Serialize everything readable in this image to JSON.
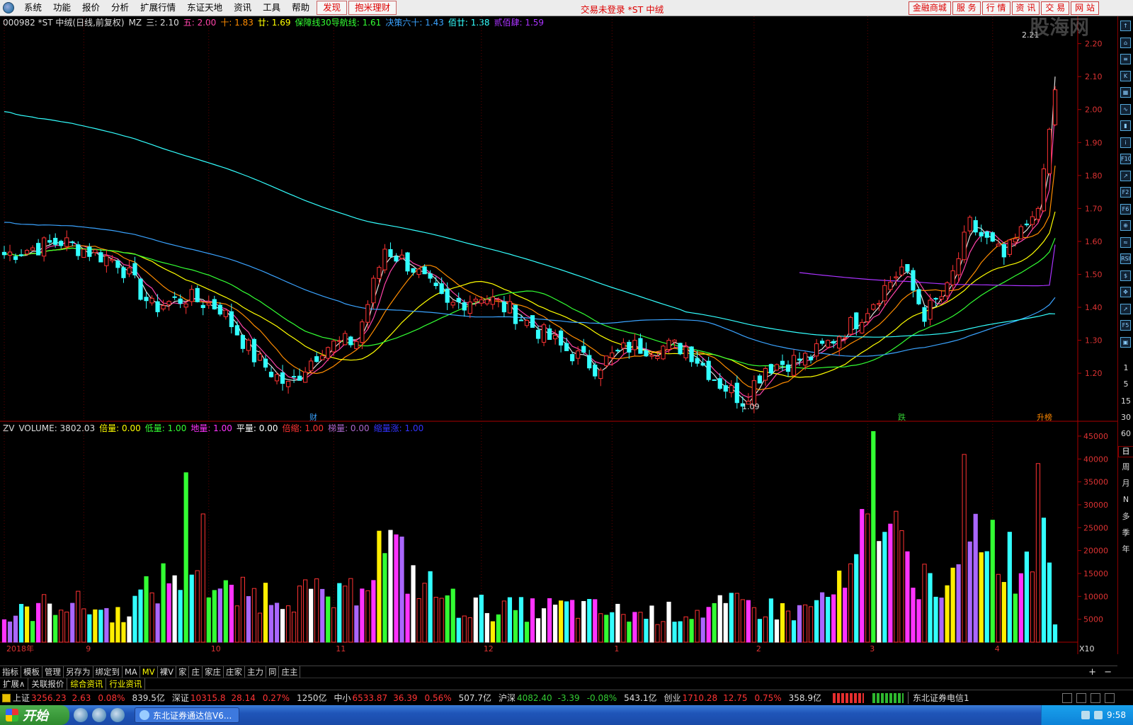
{
  "menu": {
    "items": [
      "系统",
      "功能",
      "报价",
      "分析",
      "扩展行情",
      "东证天地",
      "资讯",
      "工具",
      "帮助"
    ],
    "highlight_items": [
      "发现",
      "抱米理财"
    ],
    "status": "交易未登录 *ST 中绒",
    "right_buttons": [
      "金融商城",
      "服 务",
      "行 情",
      "资 讯",
      "交 易",
      "网 站"
    ]
  },
  "main": {
    "header_parts": [
      {
        "text": "000982 *ST 中绒(日线,前复权)",
        "color": "#dddddd"
      },
      {
        "text": "MZ",
        "color": "#dddddd"
      },
      {
        "text": "三: 2.10",
        "color": "#dddddd"
      },
      {
        "text": "五: 2.00",
        "color": "#ff44aa"
      },
      {
        "text": "十: 1.83",
        "color": "#ff8c00"
      },
      {
        "text": "廿: 1.69",
        "color": "#ffff00"
      },
      {
        "text": "保障线30导航线: 1.61",
        "color": "#33ff33"
      },
      {
        "text": "决策六十: 1.43",
        "color": "#3aa3ff"
      },
      {
        "text": "佰廿: 1.38",
        "color": "#33ffff"
      },
      {
        "text": "贰佰肆: 1.59",
        "color": "#aa33ff"
      }
    ],
    "last_price_label": "2.21",
    "low_label": "1.09",
    "event_labels": [
      {
        "text": "财",
        "color": "#3aa3ff"
      },
      {
        "text": "跌",
        "color": "#33cc33"
      },
      {
        "text": "升榜",
        "color": "#ff8800"
      }
    ]
  },
  "volume": {
    "header_parts": [
      {
        "text": "ZV",
        "color": "#dddddd"
      },
      {
        "text": "VOLUME: 3802.03",
        "color": "#dddddd"
      },
      {
        "text": "倍量: 0.00",
        "color": "#ffff00"
      },
      {
        "text": "低量: 1.00",
        "color": "#33ff33"
      },
      {
        "text": "地量: 1.00",
        "color": "#ff33ff"
      },
      {
        "text": "平量: 0.00",
        "color": "#ffffff"
      },
      {
        "text": "倍缩: 1.00",
        "color": "#ff3333"
      },
      {
        "text": "梯量: 0.00",
        "color": "#aa66cc"
      },
      {
        "text": "缩量涨: 1.00",
        "color": "#3333ff"
      }
    ],
    "x10": "X10"
  },
  "chart_data": [
    {
      "type": "candlestick",
      "title": "000982 *ST 中绒(日线,前复权)",
      "price_ticks": [
        "2.20",
        "2.10",
        "2.00",
        "1.90",
        "1.80",
        "1.70",
        "1.60",
        "1.50",
        "1.40",
        "1.30",
        "1.20"
      ],
      "price_tick_values": [
        2.2,
        2.1,
        2.0,
        1.9,
        1.8,
        1.7,
        1.6,
        1.5,
        1.4,
        1.3,
        1.2
      ],
      "ylim": [
        1.08,
        2.24
      ],
      "x_axis_labels": [
        "2018年",
        "9",
        "10",
        "11",
        "12",
        "1",
        "2",
        "3",
        "4"
      ],
      "x_axis_label_index": [
        0,
        14,
        36,
        58,
        84,
        107,
        132,
        152,
        174
      ],
      "n_bars": 186,
      "anchors": [
        [
          0,
          1.56
        ],
        [
          10,
          1.6
        ],
        [
          20,
          1.54
        ],
        [
          26,
          1.4
        ],
        [
          32,
          1.43
        ],
        [
          38,
          1.4
        ],
        [
          44,
          1.25
        ],
        [
          50,
          1.16
        ],
        [
          56,
          1.28
        ],
        [
          62,
          1.3
        ],
        [
          67,
          1.58
        ],
        [
          72,
          1.52
        ],
        [
          78,
          1.4
        ],
        [
          84,
          1.44
        ],
        [
          90,
          1.38
        ],
        [
          98,
          1.28
        ],
        [
          104,
          1.22
        ],
        [
          110,
          1.28
        ],
        [
          120,
          1.28
        ],
        [
          126,
          1.17
        ],
        [
          130,
          1.12
        ],
        [
          134,
          1.22
        ],
        [
          142,
          1.25
        ],
        [
          150,
          1.36
        ],
        [
          158,
          1.52
        ],
        [
          162,
          1.38
        ],
        [
          166,
          1.45
        ],
        [
          170,
          1.65
        ],
        [
          176,
          1.55
        ],
        [
          182,
          1.7
        ],
        [
          185,
          2.06
        ]
      ],
      "ma_series": [
        {
          "name": "三",
          "window": 3,
          "value": 2.1,
          "color": "#dddddd"
        },
        {
          "name": "五",
          "window": 5,
          "value": 2.0,
          "color": "#ff44aa"
        },
        {
          "name": "十",
          "window": 10,
          "value": 1.83,
          "color": "#ff8c00"
        },
        {
          "name": "廿",
          "window": 20,
          "value": 1.69,
          "color": "#ffff00"
        },
        {
          "name": "保障线30导航线",
          "window": 30,
          "value": 1.61,
          "color": "#33ff33"
        },
        {
          "name": "决策六十",
          "window": 60,
          "value": 1.43,
          "color": "#3aa3ff"
        },
        {
          "name": "佰廿",
          "window": 120,
          "value": 1.38,
          "color": "#33ffff"
        },
        {
          "name": "贰佰肆",
          "window": 240,
          "value": 1.59,
          "color": "#aa33ff"
        }
      ],
      "annotations": [
        "2.21",
        "1.09"
      ]
    },
    {
      "type": "bar",
      "title": "ZV VOLUME: 3802.03",
      "vol_ticks": [
        "45000",
        "40000",
        "35000",
        "30000",
        "25000",
        "20000",
        "15000",
        "10000",
        "5000"
      ],
      "vol_tick_values": [
        45000,
        40000,
        35000,
        30000,
        25000,
        20000,
        15000,
        10000,
        5000
      ],
      "ylim": [
        0,
        47000
      ],
      "volume_anchors": [
        [
          0,
          5000
        ],
        [
          10,
          9000
        ],
        [
          20,
          6000
        ],
        [
          30,
          15000
        ],
        [
          40,
          10000
        ],
        [
          50,
          11000
        ],
        [
          60,
          9000
        ],
        [
          67,
          22000
        ],
        [
          72,
          14000
        ],
        [
          80,
          8000
        ],
        [
          90,
          7000
        ],
        [
          100,
          7500
        ],
        [
          110,
          6000
        ],
        [
          120,
          6500
        ],
        [
          130,
          8000
        ],
        [
          140,
          6500
        ],
        [
          148,
          12000
        ],
        [
          155,
          25000
        ],
        [
          160,
          16000
        ],
        [
          166,
          11000
        ],
        [
          172,
          26000
        ],
        [
          178,
          17000
        ],
        [
          184,
          21000
        ],
        [
          185,
          3800
        ]
      ],
      "spikes": [
        [
          32,
          37000
        ],
        [
          35,
          28000
        ],
        [
          153,
          46000
        ],
        [
          169,
          41000
        ],
        [
          182,
          39000
        ],
        [
          151,
          29000
        ],
        [
          152,
          28000
        ],
        [
          154,
          22000
        ],
        [
          155,
          24000
        ]
      ]
    }
  ],
  "sidebar": {
    "icons": [
      "up-arrow-icon",
      "home-icon",
      "list-icon",
      "k-icon",
      "grid-icon",
      "line-icon",
      "bar-icon",
      "info-icon",
      "f10-icon",
      "rise-icon",
      "f2-icon",
      "f6-icon",
      "zoom-icon",
      "wave-icon",
      "rsi-icon",
      "dollar-icon",
      "move-icon",
      "arrow-icon",
      "f5-icon",
      "chart-icon"
    ],
    "icon_texts": [
      "↑",
      "⌂",
      "≡",
      "K",
      "▦",
      "∿",
      "▮",
      "i",
      "F10",
      "↗",
      "F2",
      "F6",
      "⊕",
      "≈",
      "RSI",
      "$",
      "✥",
      "➚",
      "F5",
      "▣"
    ],
    "periods": [
      "1",
      "5",
      "15",
      "30",
      "60",
      "日",
      "周",
      "月",
      "N",
      "多",
      "季",
      "年"
    ],
    "selected_period": "日"
  },
  "x_axis": {
    "period_label": "日线"
  },
  "tabs1": {
    "items": [
      "指标",
      "模板",
      "管理",
      "另存为",
      "绑定到",
      "MA",
      "MV",
      "裸V",
      "家",
      "庄",
      "家庄",
      "庄家",
      "主力",
      "同",
      "庄主"
    ],
    "plus": "+",
    "minus": "−"
  },
  "tabs2": {
    "items": [
      "扩展∧",
      "关联报价",
      "综合资讯",
      "行业资讯"
    ]
  },
  "ticker": {
    "items": [
      {
        "name": "上证",
        "price": "3256.23",
        "chg": "2.63",
        "pct": "0.08%",
        "amt": "839.5亿",
        "dir": "up"
      },
      {
        "name": "深证",
        "price": "10315.8",
        "chg": "28.14",
        "pct": "0.27%",
        "amt": "1250亿",
        "dir": "up"
      },
      {
        "name": "中小",
        "price": "6533.87",
        "chg": "36.39",
        "pct": "0.56%",
        "amt": "507.7亿",
        "dir": "up"
      },
      {
        "name": "沪深",
        "price": "4082.40",
        "chg": "-3.39",
        "pct": "-0.08%",
        "amt": "543.1亿",
        "dir": "dn"
      },
      {
        "name": "创业",
        "price": "1710.28",
        "chg": "12.75",
        "pct": "0.75%",
        "amt": "358.9亿",
        "dir": "up"
      }
    ],
    "broker": "东北证券电信1"
  },
  "taskbar": {
    "start": "开始",
    "task": "东北证券通达信V6...",
    "clock": "9:58"
  },
  "watermark": "股海网"
}
